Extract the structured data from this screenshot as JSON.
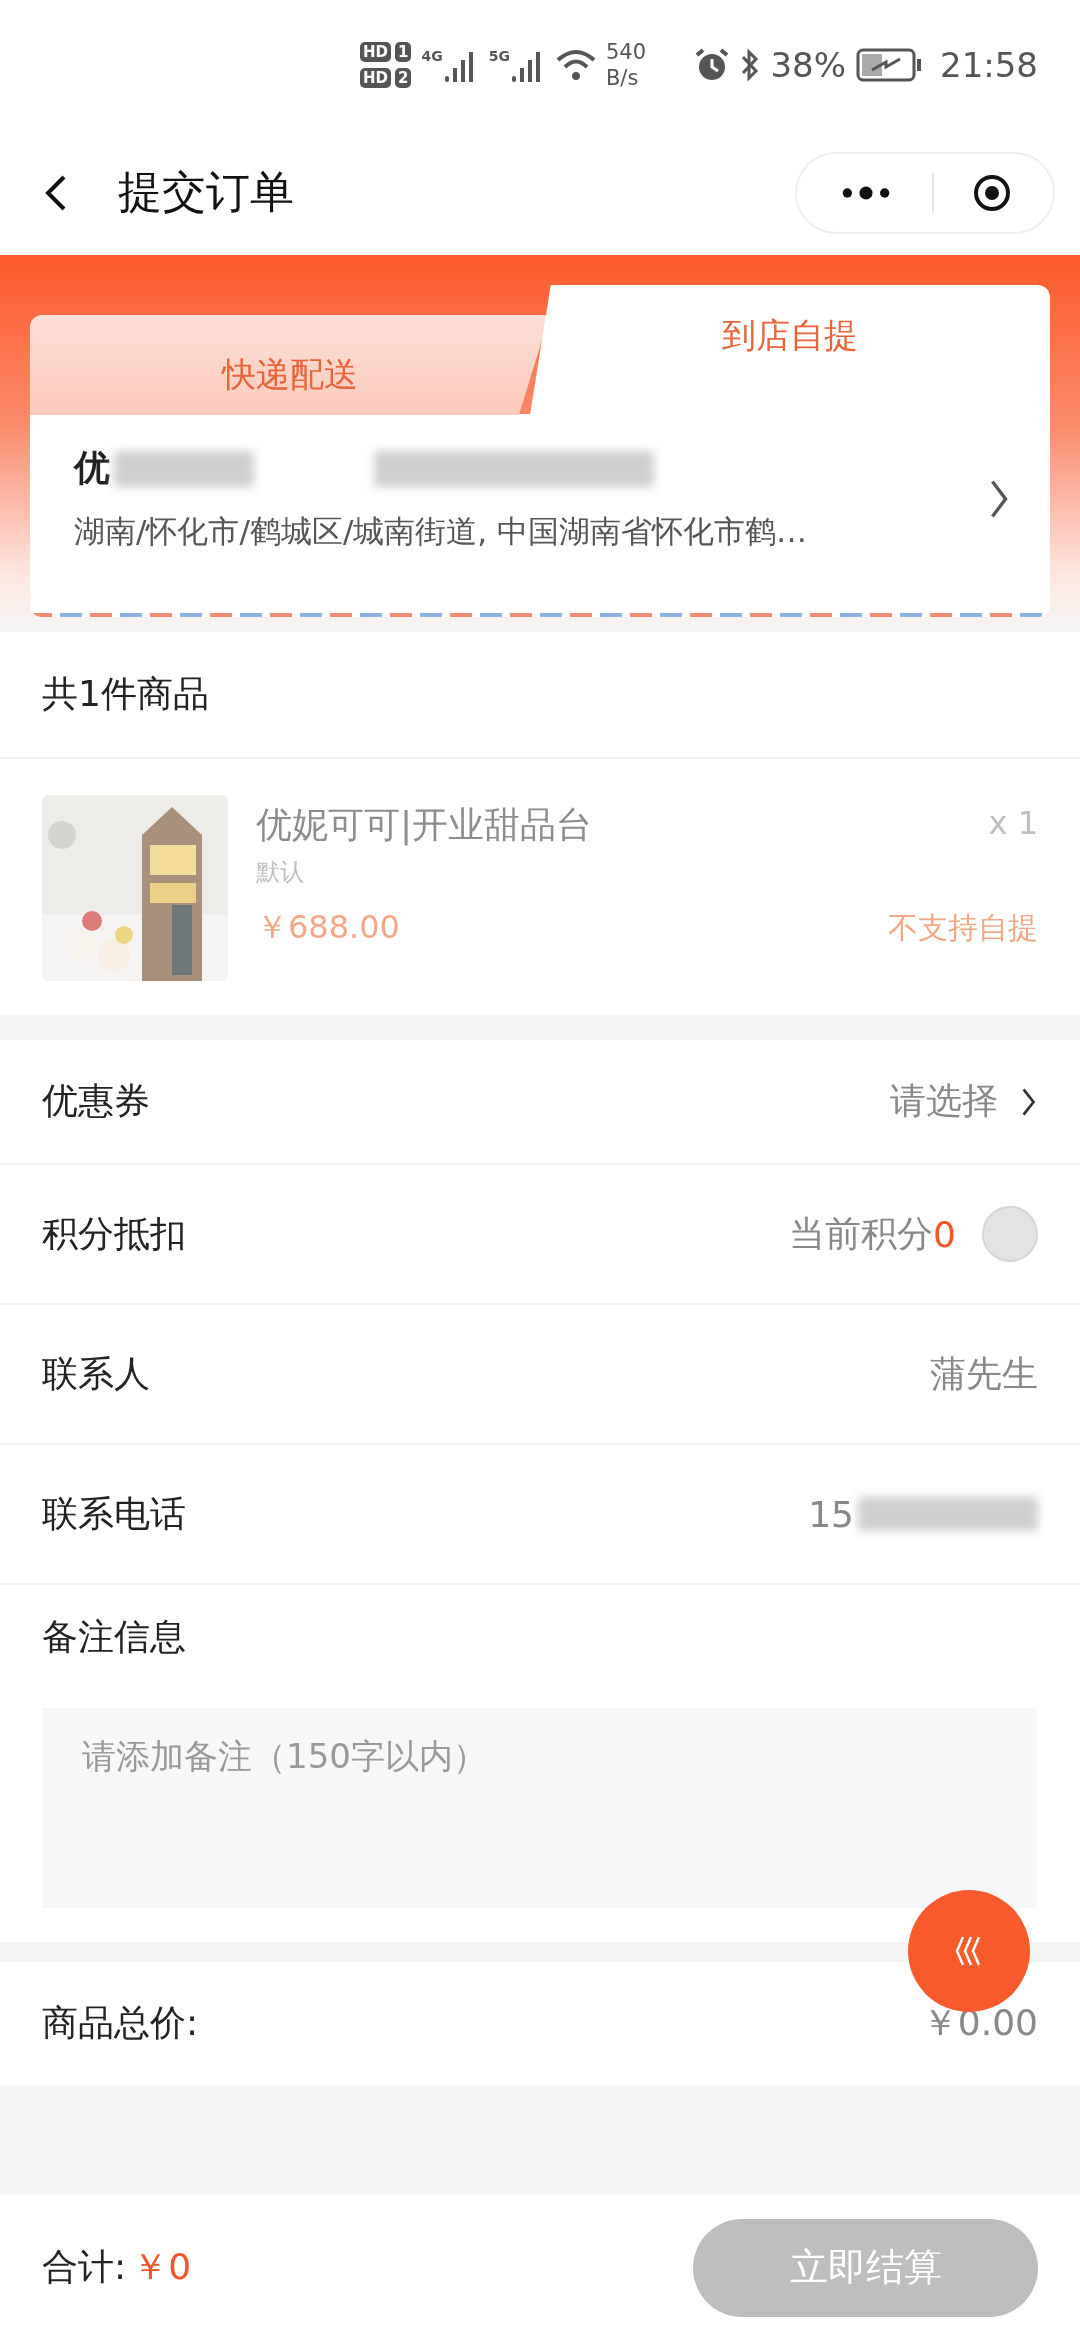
{
  "status_bar": {
    "sims": [
      {
        "label": "HD",
        "slot": "1"
      },
      {
        "label": "HD",
        "slot": "2"
      }
    ],
    "signals": [
      {
        "type": "4G"
      },
      {
        "type": "5G"
      }
    ],
    "net_speed": [
      "540",
      "B/s"
    ],
    "battery": "38%",
    "time": "21:58"
  },
  "nav": {
    "title": "提交订单"
  },
  "tabs": [
    {
      "label": "快递配送",
      "selected": false
    },
    {
      "label": "到店自提",
      "selected": true
    }
  ],
  "address": {
    "name": "优",
    "address": "湖南/怀化市/鹤城区/城南街道, 中国湖南省怀化市鹤…"
  },
  "items_count": "共1件商品",
  "product": {
    "kind": "picture",
    "name": "优妮可可|开业甜品台",
    "spec": "默认",
    "price": "￥688.00",
    "quantity": "x 1",
    "note": "不支持自提"
  },
  "rows": [
    {
      "kind": "link",
      "label": "优惠券",
      "value": "请选择"
    },
    {
      "kind": "points",
      "label": "积分抵扣",
      "value": "当前积分",
      "points": "0",
      "checked": false
    },
    {
      "kind": "text",
      "label": "联系人",
      "value": "蒲先生"
    },
    {
      "kind": "redacted",
      "label": "联系电话",
      "value": "15"
    }
  ],
  "remark": {
    "label": "备注信息",
    "placeholder": "请添加备注（150字以内）"
  },
  "subtotal": {
    "label": "商品总价:",
    "value": "￥0.00"
  },
  "footer": {
    "total_label": "合计:",
    "total": "￥0",
    "button": "立即结算",
    "disabled": true
  }
}
